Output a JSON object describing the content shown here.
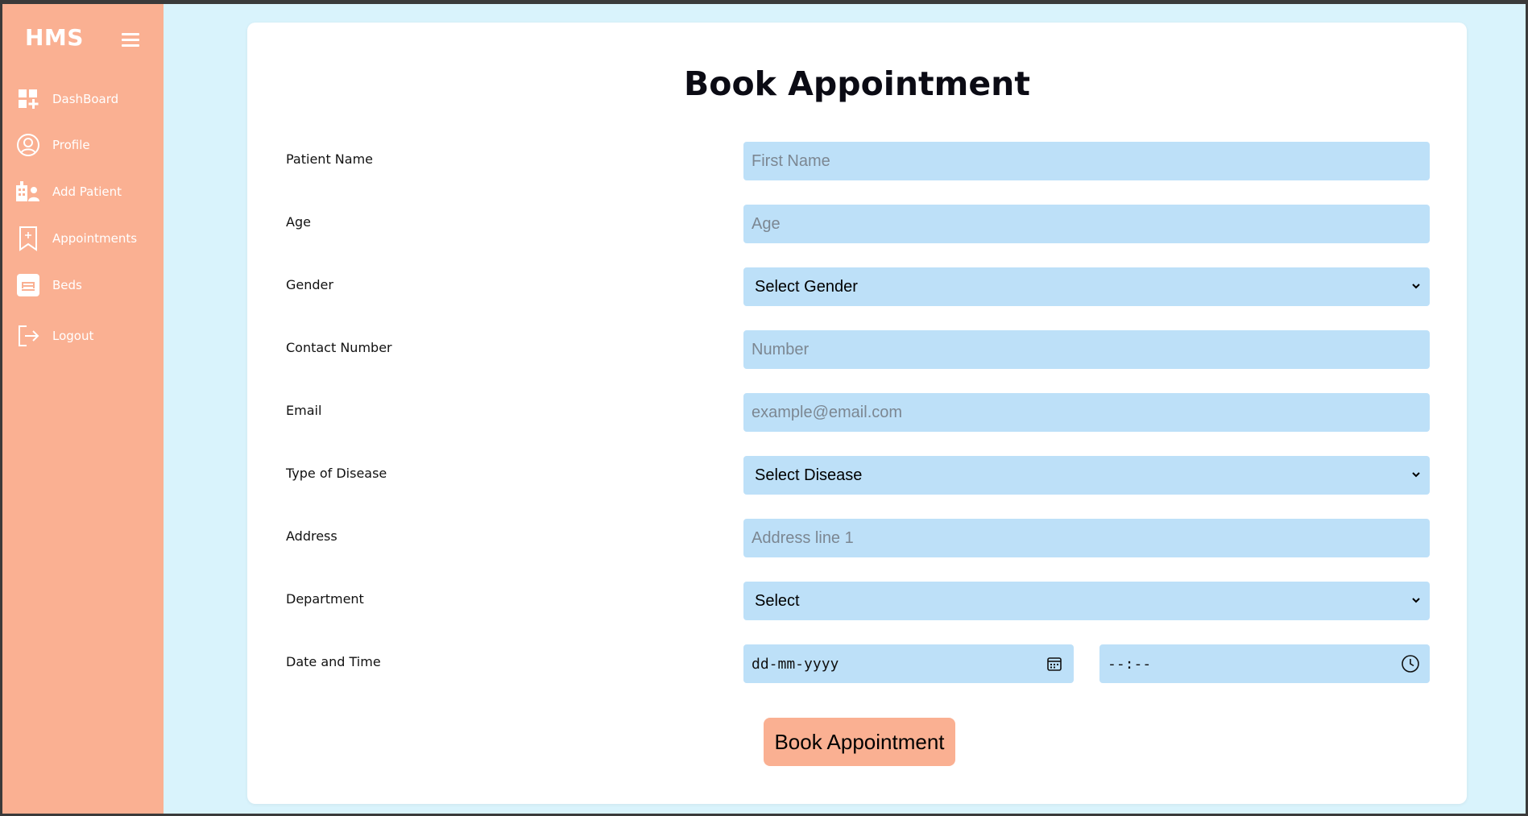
{
  "app": {
    "brand": "HMS"
  },
  "sidebar": {
    "items": [
      {
        "label": "DashBoard",
        "icon": "dashboard-icon"
      },
      {
        "label": "Profile",
        "icon": "user-circle-icon"
      },
      {
        "label": "Add Patient",
        "icon": "add-patient-icon"
      },
      {
        "label": "Appointments",
        "icon": "bookmark-plus-icon"
      },
      {
        "label": "Beds",
        "icon": "bed-icon"
      },
      {
        "label": "Logout",
        "icon": "logout-icon"
      }
    ]
  },
  "form": {
    "title": "Book Appointment",
    "fields": {
      "patient_name": {
        "label": "Patient Name",
        "placeholder": "First Name"
      },
      "age": {
        "label": "Age",
        "placeholder": "Age"
      },
      "gender": {
        "label": "Gender",
        "selected": "Select Gender"
      },
      "contact": {
        "label": "Contact Number",
        "placeholder": "Number"
      },
      "email": {
        "label": "Email",
        "placeholder": "example@email.com"
      },
      "disease": {
        "label": "Type of Disease",
        "selected": "Select Disease"
      },
      "address": {
        "label": "Address",
        "placeholder": "Address line 1"
      },
      "department": {
        "label": "Department",
        "selected": "Select"
      },
      "datetime": {
        "label": "Date and Time",
        "date_placeholder": "dd-mm-yyyy",
        "time_placeholder": "--:--"
      }
    },
    "submit_label": "Book Appointment"
  },
  "colors": {
    "sidebar": "#fab092",
    "background": "#d9f3fc",
    "field": "#bde0f8",
    "button": "#fab092"
  }
}
